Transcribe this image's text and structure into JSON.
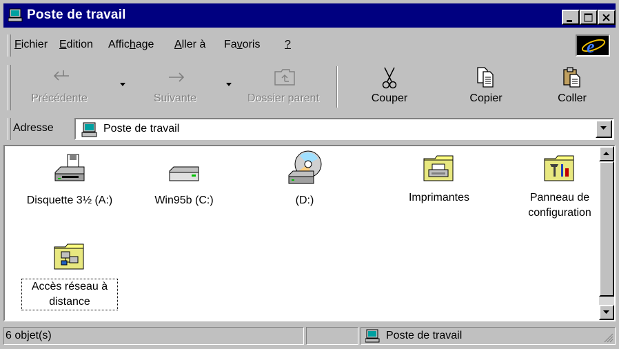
{
  "window": {
    "title": "Poste de travail"
  },
  "menu": {
    "fichier": {
      "pre": "",
      "accel": "F",
      "post": "ichier"
    },
    "edition": {
      "pre": "",
      "accel": "E",
      "post": "dition"
    },
    "affichage": {
      "pre": "Affic",
      "accel": "h",
      "post": "age"
    },
    "aller": {
      "pre": "",
      "accel": "A",
      "post": "ller à"
    },
    "favoris": {
      "pre": "Fa",
      "accel": "v",
      "post": "oris"
    },
    "aide": {
      "pre": "",
      "accel": "?",
      "post": ""
    }
  },
  "toolbar": {
    "precedente": "Précédente",
    "suivante": "Suivante",
    "dossier_parent": "Dossier parent",
    "couper": "Couper",
    "copier": "Copier",
    "coller": "Coller"
  },
  "address": {
    "label": "Adresse",
    "value": "Poste de travail"
  },
  "icons": [
    {
      "label": "Disquette 3½ (A:)",
      "icon": "floppy-drive-icon"
    },
    {
      "label": "Win95b (C:)",
      "icon": "hard-drive-icon"
    },
    {
      "label": "(D:)",
      "icon": "cd-drive-icon"
    },
    {
      "label": "Imprimantes",
      "icon": "printers-folder-icon"
    },
    {
      "label": "Panneau de configuration",
      "icon": "control-panel-folder-icon"
    },
    {
      "label": "Accès réseau à distance",
      "icon": "dial-up-folder-icon"
    }
  ],
  "status": {
    "count": "6 objet(s)",
    "zone": "Poste de travail"
  },
  "colors": {
    "titlebar": "#000080",
    "face": "#c0c0c0",
    "folder": "#ffff80"
  }
}
